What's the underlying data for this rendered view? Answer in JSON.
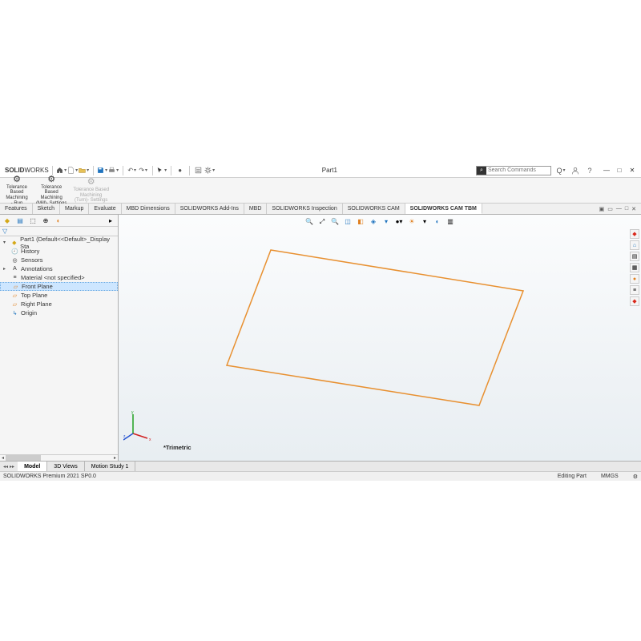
{
  "title": {
    "brand_prefix": "SOLID",
    "brand_suffix": "WORKS",
    "document": "Part1"
  },
  "search": {
    "placeholder": "Search Commands"
  },
  "ribbon": {
    "buttons": [
      {
        "label_lines": [
          "Tolerance",
          "Based",
          "Machining",
          "- Run"
        ],
        "icon": "gear"
      },
      {
        "label_lines": [
          "Tolerance",
          "Based",
          "Machining",
          "(Mill)- Settings"
        ],
        "icon": "gear"
      },
      {
        "label_lines": [
          "Tolerance Based",
          "Machining",
          "(Turn)- Settings"
        ],
        "icon": "gear",
        "disabled": true
      }
    ]
  },
  "command_tabs": [
    "Features",
    "Sketch",
    "Markup",
    "Evaluate",
    "MBD Dimensions",
    "SOLIDWORKS Add-Ins",
    "MBD",
    "SOLIDWORKS Inspection",
    "SOLIDWORKS CAM",
    "SOLIDWORKS CAM TBM"
  ],
  "command_tab_active": 9,
  "tree": {
    "root": "Part1  (Default<<Default>_Display Sta",
    "items": [
      {
        "label": "History",
        "icon": "history"
      },
      {
        "label": "Sensors",
        "icon": "sensor"
      },
      {
        "label": "Annotations",
        "icon": "annotation",
        "expandable": true
      },
      {
        "label": "Material <not specified>",
        "icon": "material"
      },
      {
        "label": "Front Plane",
        "icon": "plane",
        "selected": true
      },
      {
        "label": "Top Plane",
        "icon": "plane"
      },
      {
        "label": "Right Plane",
        "icon": "plane"
      },
      {
        "label": "Origin",
        "icon": "origin"
      }
    ]
  },
  "viewport": {
    "orientation_label": "*Trimetric",
    "triad_axes": [
      "x",
      "y",
      "z"
    ]
  },
  "bottom_tabs": [
    "Model",
    "3D Views",
    "Motion Study 1"
  ],
  "bottom_tab_active": 0,
  "statusbar": {
    "left": "SOLIDWORKS Premium 2021 SP0.0",
    "mode": "Editing Part",
    "units": "MMGS"
  }
}
